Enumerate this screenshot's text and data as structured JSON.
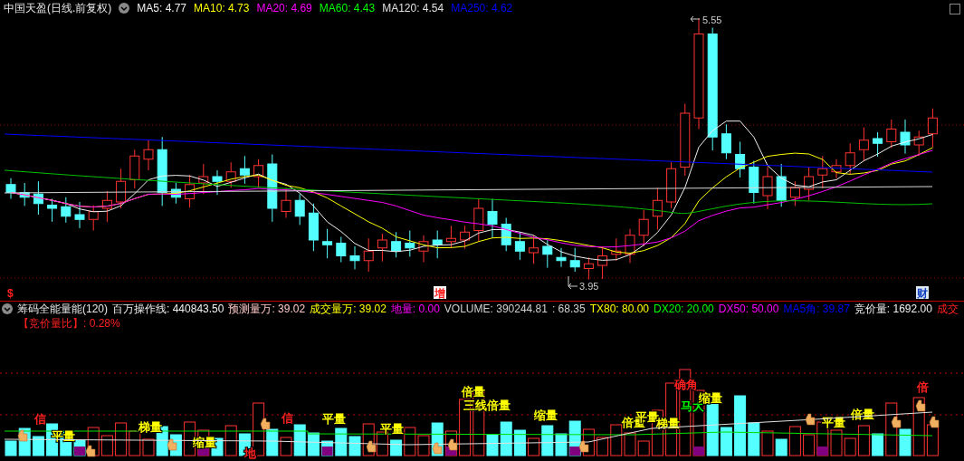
{
  "chart_header": {
    "title": "中国天盈(日线.前复权)",
    "indicators": [
      {
        "label": "MA5: 4.77",
        "color": "#f0f0f0"
      },
      {
        "label": "MA10: 4.73",
        "color": "#ffff00"
      },
      {
        "label": "MA20: 4.69",
        "color": "#ff00ff"
      },
      {
        "label": "MA60: 4.43",
        "color": "#00ff00"
      },
      {
        "label": "MA120: 4.54",
        "color": "#e0e0e0"
      },
      {
        "label": "MA250: 4.62",
        "color": "#0000ff"
      }
    ]
  },
  "price_chart": {
    "high_label": "5.55",
    "low_label": "3.95",
    "markers": [
      {
        "text": "$",
        "color": "#ff2020"
      },
      {
        "text": "增",
        "color": "#ff2020"
      },
      {
        "text": "财",
        "color": "#1040c0"
      }
    ]
  },
  "volume_header": {
    "title": "筹码全能量能(120)",
    "indicators": [
      {
        "label": "百万操作线: 440843.50",
        "color": "#f0f0f0"
      },
      {
        "label": "预测量万: 39.02",
        "color": "#ffc8c8"
      },
      {
        "label": "成交量万: 39.02",
        "color": "#ffff00"
      },
      {
        "label": "地量: 0.00",
        "color": "#ff00ff"
      },
      {
        "label": "VOLUME: 390244.81",
        "color": "#d0d0d0"
      },
      {
        "label": ": 68.35",
        "color": "#d0d0d0"
      },
      {
        "label": "TX80: 80.00",
        "color": "#ffff00"
      },
      {
        "label": "DX20: 20.00",
        "color": "#00ff00"
      },
      {
        "label": "DX50: 50.00",
        "color": "#ff00ff"
      },
      {
        "label": "MA5角: 39.87",
        "color": "#0000ff"
      },
      {
        "label": "竞价量: 1692.00",
        "color": "#f0f0f0"
      },
      {
        "label": "成交",
        "color": "#ff2020"
      }
    ],
    "ratio": "【竞价量比】: 0.28%"
  },
  "volume_chart": {
    "labels": [
      {
        "text": "信",
        "color": "#ff2020"
      },
      {
        "text": "平量",
        "color": "#ffff00"
      },
      {
        "text": "梯量",
        "color": "#ffff00"
      },
      {
        "text": "缩量",
        "color": "#ffff00"
      },
      {
        "text": "地",
        "color": "#ff2020"
      },
      {
        "text": "信",
        "color": "#ff2020"
      },
      {
        "text": "平量",
        "color": "#ffff00"
      },
      {
        "text": "平量",
        "color": "#ffff00"
      },
      {
        "text": "倍量",
        "color": "#ffff00"
      },
      {
        "text": "三线倍量",
        "color": "#ffff00"
      },
      {
        "text": "缩量",
        "color": "#ffff00"
      },
      {
        "text": "倍量",
        "color": "#ffff00"
      },
      {
        "text": "平量",
        "color": "#ffff00"
      },
      {
        "text": "梯量",
        "color": "#ffff00"
      },
      {
        "text": "确角",
        "color": "#ff2020"
      },
      {
        "text": "马大",
        "color": "#00ff00"
      },
      {
        "text": "缩量",
        "color": "#ffff00"
      },
      {
        "text": "平量",
        "color": "#ffff00"
      },
      {
        "text": "倍量",
        "color": "#ffff00"
      },
      {
        "text": "倍",
        "color": "#ff2020"
      }
    ]
  }
}
